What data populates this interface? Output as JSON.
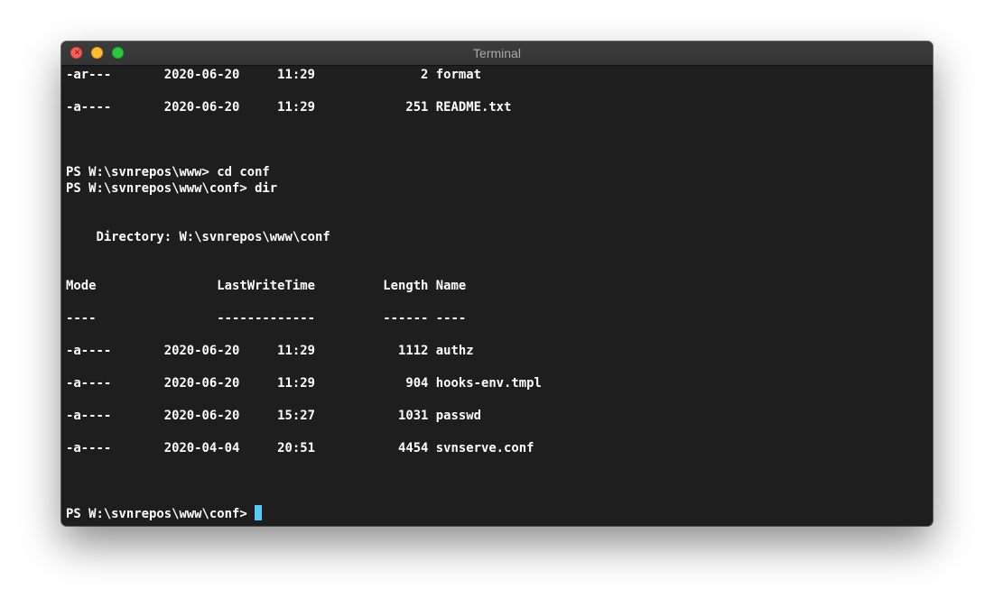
{
  "window": {
    "title": "Terminal"
  },
  "terminal": {
    "lines": [
      "-ar---       2020-06-20     11:29              2 format",
      "-a----       2020-06-20     11:29            251 README.txt",
      "PS W:\\svnrepos\\www> cd conf",
      "PS W:\\svnrepos\\www\\conf> dir",
      "    Directory: W:\\svnrepos\\www\\conf",
      "Mode                LastWriteTime         Length Name",
      "----                -------------         ------ ----",
      "-a----       2020-06-20     11:29           1112 authz",
      "-a----       2020-06-20     11:29            904 hooks-env.tmpl",
      "-a----       2020-06-20     15:27           1031 passwd",
      "-a----       2020-04-04     20:51           4454 svnserve.conf",
      "PS W:\\svnrepos\\www\\conf> "
    ],
    "cursor_color": "#5ac8fa"
  }
}
